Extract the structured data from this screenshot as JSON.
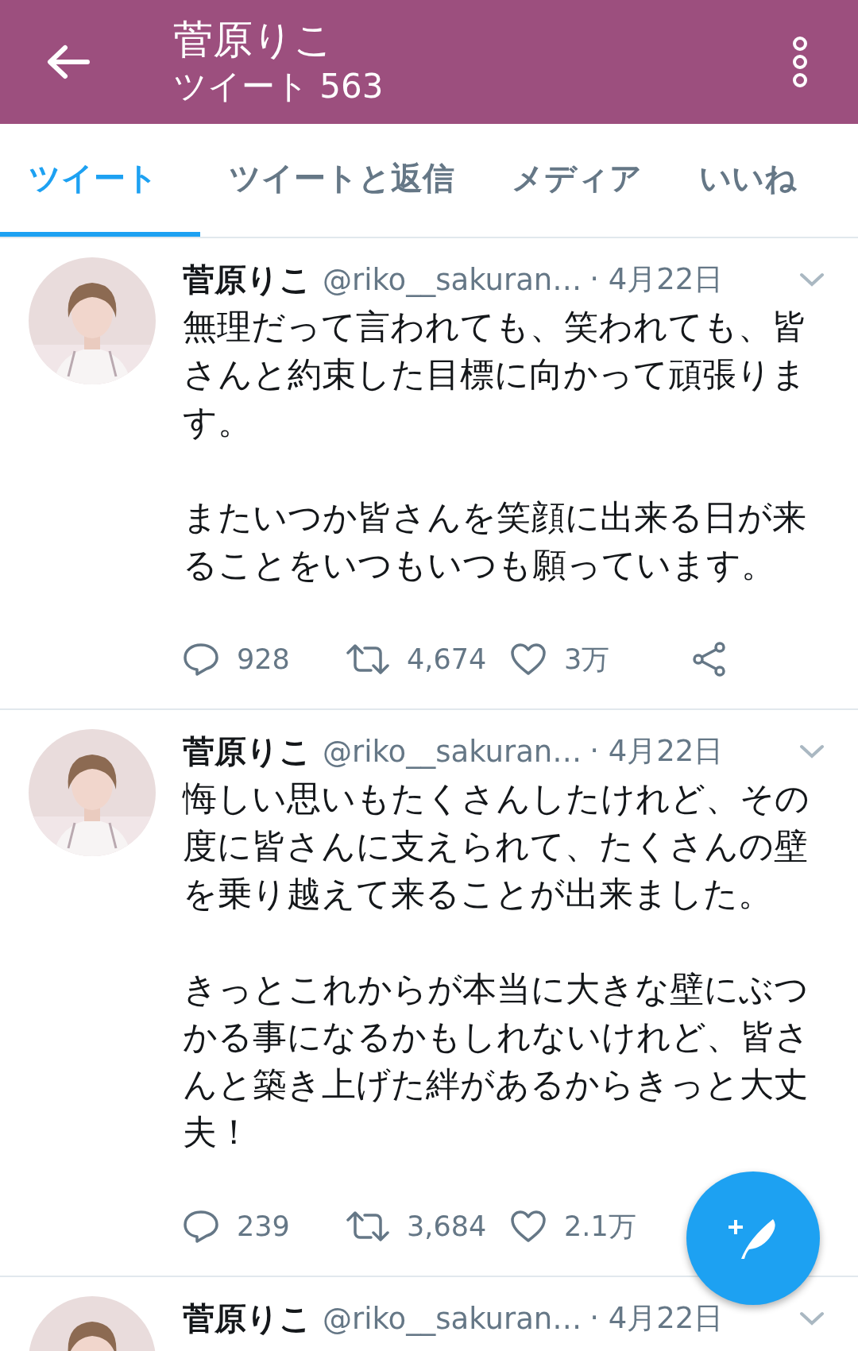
{
  "header": {
    "title": "菅原りこ",
    "subtitle": "ツイート 563"
  },
  "tabs": [
    {
      "label": "ツイート",
      "selected": true
    },
    {
      "label": "ツイートと返信",
      "selected": false
    },
    {
      "label": "メディア",
      "selected": false
    },
    {
      "label": "いいね",
      "selected": false
    }
  ],
  "tweets": [
    {
      "name": "菅原りこ",
      "handle": "@riko__sakuran…",
      "date": "· 4月22日",
      "paragraphs": [
        "無理だって言われても、笑われても、皆さんと約束した目標に向かって頑張ります。",
        "またいつか皆さんを笑顔に出来る日が来ることをいつもいつも願っています。"
      ],
      "replies": "928",
      "retweets": "4,674",
      "likes": "3万",
      "share_visible": true
    },
    {
      "name": "菅原りこ",
      "handle": "@riko__sakuran…",
      "date": "· 4月22日",
      "paragraphs": [
        "悔しい思いもたくさんしたけれど、その度に皆さんに支えられて、たくさんの壁を乗り越えて来ることが出来ました。",
        "きっとこれからが本当に大きな壁にぶつかる事になるかもしれないけれど、皆さんと築き上げた絆があるからきっと大丈夫！"
      ],
      "replies": "239",
      "retweets": "3,684",
      "likes": "2.1万"
    },
    {
      "name": "菅原りこ",
      "handle": "@riko__sakuran…",
      "date": "· 4月22日"
    }
  ]
}
